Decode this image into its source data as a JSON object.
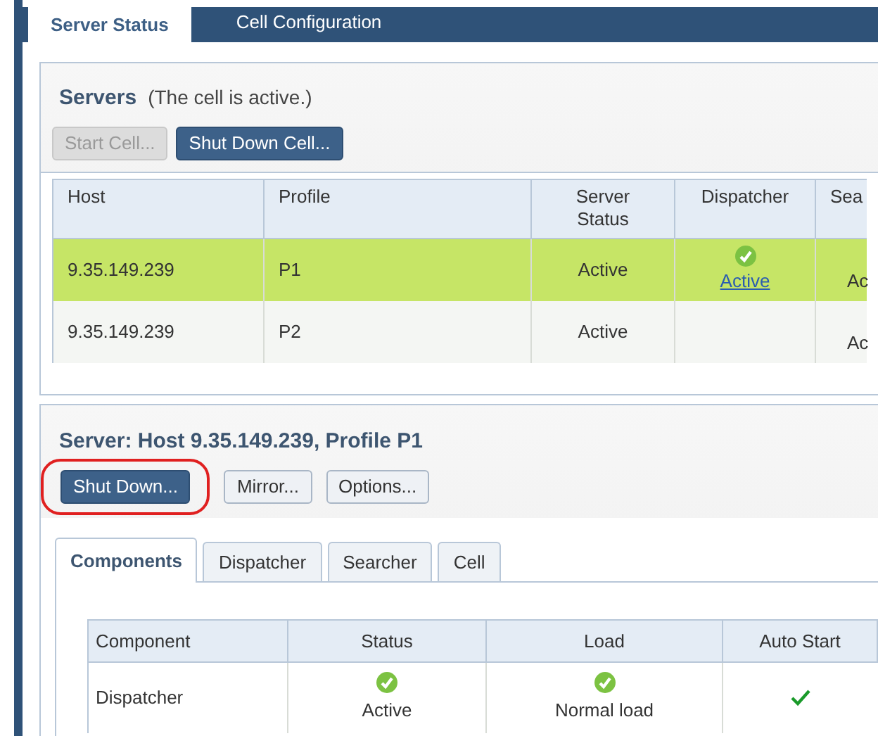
{
  "tabs": [
    {
      "label": "Server Status",
      "selected": true
    },
    {
      "label": "Cell Configuration",
      "selected": false
    }
  ],
  "servers": {
    "title": "Servers",
    "note": "(The cell is active.)",
    "buttons": [
      {
        "label": "Start Cell...",
        "kind": "primary",
        "disabled": true
      },
      {
        "label": "Shut Down Cell...",
        "kind": "primary",
        "disabled": false
      }
    ],
    "table": {
      "columns": [
        "Host",
        "Profile",
        "Server Status",
        "Dispatcher",
        "Sea"
      ],
      "rows": [
        {
          "selected": true,
          "host": "9.35.149.239",
          "profile": "P1",
          "server_status": "Active",
          "dispatcher": {
            "status": "Active",
            "link": true
          },
          "column_5": "Ac"
        },
        {
          "selected": false,
          "host": "9.35.149.239",
          "profile": "P2",
          "server_status": "Active",
          "column_5": "Ac"
        }
      ]
    }
  },
  "server": {
    "title": "Server: Host 9.35.149.239, Profile P1",
    "buttons": [
      {
        "label": "Shut Down...",
        "kind": "primary",
        "highlighted": true
      },
      {
        "label": "Mirror...",
        "kind": "secondary",
        "highlighted": false
      },
      {
        "label": "Options...",
        "kind": "secondary",
        "highlighted": false
      }
    ],
    "tabs": [
      {
        "label": "Components",
        "selected": true
      },
      {
        "label": "Dispatcher",
        "selected": false
      },
      {
        "label": "Searcher",
        "selected": false
      },
      {
        "label": "Cell",
        "selected": false
      }
    ],
    "components": {
      "columns": [
        "Component",
        "Status",
        "Load",
        "Auto Start"
      ],
      "rows": [
        {
          "component": "Dispatcher",
          "status": "Active",
          "load": "Normal load",
          "auto_start": true
        }
      ]
    }
  }
}
